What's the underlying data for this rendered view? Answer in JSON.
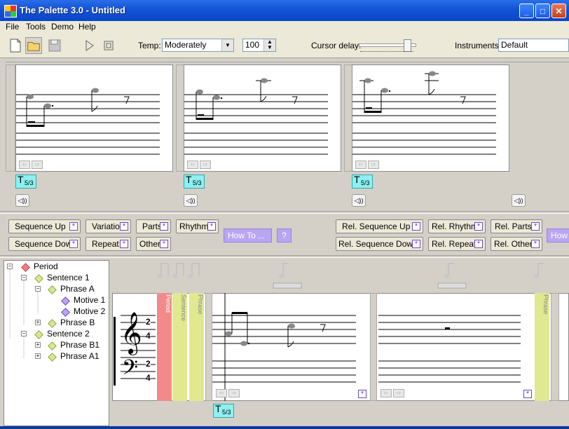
{
  "window": {
    "title": "The Palette 3.0 - Untitled"
  },
  "menu": [
    "File",
    "Tools",
    "Demo",
    "Help"
  ],
  "toolbar": {
    "tempo_label": "Temp:",
    "tempo_value": "Moderately",
    "bpm_value": "100",
    "cursor_delay_label": "Cursor delay:",
    "instruments_label": "Instruments:",
    "instruments_value": "Default"
  },
  "palette": {
    "badge_fraction": "5/3"
  },
  "left_buttons": {
    "sequence_up": "Sequence Up",
    "variation": "Variation",
    "parts": "Parts",
    "rhythm": "Rhythm",
    "sequence_down": "Sequence Down",
    "repeat": "Repeat",
    "other": "Other",
    "how_to": "How To ...",
    "help": "?"
  },
  "right_buttons": {
    "rel_sequence_up": "Rel. Sequence Up",
    "rel_rhythm": "Rel. Rhythm",
    "rel_parts": "Rel. Parts",
    "rel_sequence_down": "Rel. Sequence Down",
    "rel_repeat": "Rel. Repeat",
    "rel_other": "Rel. Other",
    "how_to_cut": "How"
  },
  "tree": {
    "root": "Period",
    "sentence1": "Sentence 1",
    "phrase_a": "Phrase A",
    "motive1": "Motive 1",
    "motive2": "Motive 2",
    "phrase_b": "Phrase B",
    "sentence2": "Sentence 2",
    "phrase_b1": "Phrase B1",
    "phrase_a1": "Phrase A1"
  },
  "score": {
    "time_sig_top": "2",
    "time_sig_bottom": "4",
    "tab_period": "Period",
    "tab_sentence": "Sentence",
    "tab_phrase": "Phrase",
    "tab_phrase2": "Phrase",
    "badge_fraction": "5/3"
  },
  "colors": {
    "titlebar": "#1352d6",
    "badge": "#8ef0f0",
    "period_tab": "#f28a8a",
    "sentence_tab": "#e0e890",
    "accent_purple": "#7a3ad0"
  }
}
